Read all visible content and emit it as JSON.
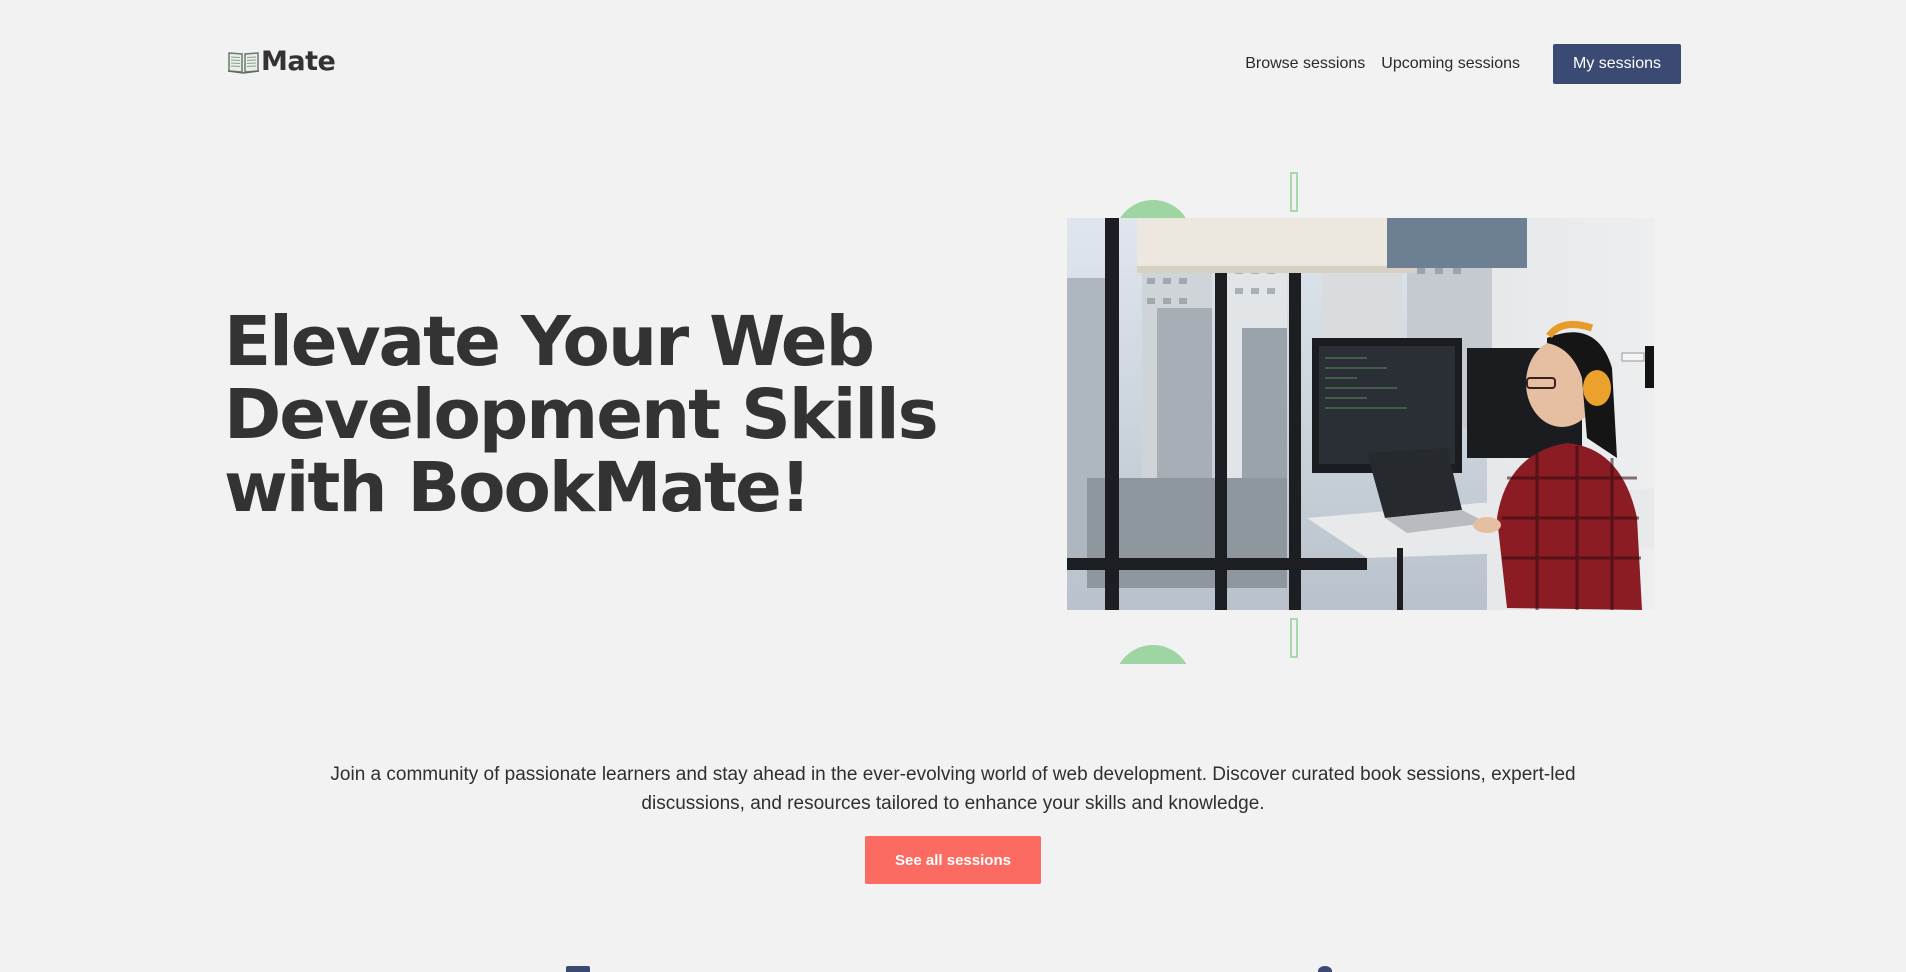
{
  "header": {
    "logo_text": "Mate",
    "logo_icon": "open-book-icon",
    "nav": {
      "browse_sessions": "Browse sessions",
      "upcoming_sessions": "Upcoming sessions",
      "my_sessions": "My sessions"
    }
  },
  "hero": {
    "title_line1": "Elevate Your Web",
    "title_line2": "Development Skills",
    "title_line3": "with BookMate!"
  },
  "intro": {
    "text": "Join a community of passionate learners and stay ahead in the ever-evolving world of web development. Discover curated book sessions, expert-led discussions, and resources tailored to enhance your skills and knowledge.",
    "cta_label": "See all sessions"
  },
  "colors": {
    "background": "#f2f2f2",
    "primary": "#3a4a72",
    "accent": "#fb6b61",
    "decor_green": "#9fd5a3",
    "text": "#333333"
  }
}
